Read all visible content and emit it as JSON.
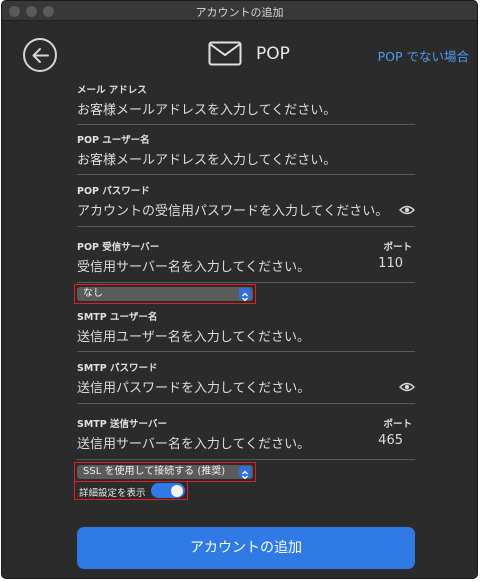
{
  "window": {
    "title": "アカウントの追加"
  },
  "header": {
    "title": "POP",
    "alt_link": "POP でない場合"
  },
  "fields": {
    "email": {
      "label": "メール アドレス",
      "placeholder": "お客様メールアドレスを入力してください。"
    },
    "pop_user": {
      "label": "POP ユーザー名",
      "placeholder": "お客様メールアドレスを入力してください。"
    },
    "pop_password": {
      "label": "POP パスワード",
      "placeholder": "アカウントの受信用パスワードを入力してください。"
    },
    "pop_server": {
      "label": "POP 受信サーバー",
      "placeholder": "受信用サーバー名を入力してください。",
      "port_label": "ポート",
      "port_value": "110"
    },
    "smtp_user": {
      "label": "SMTP ユーザー名",
      "placeholder": "送信用ユーザー名を入力してください。"
    },
    "smtp_password": {
      "label": "SMTP パスワード",
      "placeholder": "送信用パスワードを入力してください。"
    },
    "smtp_server": {
      "label": "SMTP 送信サーバー",
      "placeholder": "送信用サーバー名を入力してください。",
      "port_label": "ポート",
      "port_value": "465"
    }
  },
  "pop_security": {
    "selected": "なし"
  },
  "smtp_security": {
    "selected": "SSL を使用して接続する (推奨)"
  },
  "advanced": {
    "label": "詳細設定を表示",
    "enabled": true
  },
  "submit": {
    "label": "アカウントの追加"
  },
  "colors": {
    "accent": "#2f7ae5",
    "link": "#4a9cf2",
    "background": "#2b2b2b",
    "highlight_border": "#e02020"
  }
}
